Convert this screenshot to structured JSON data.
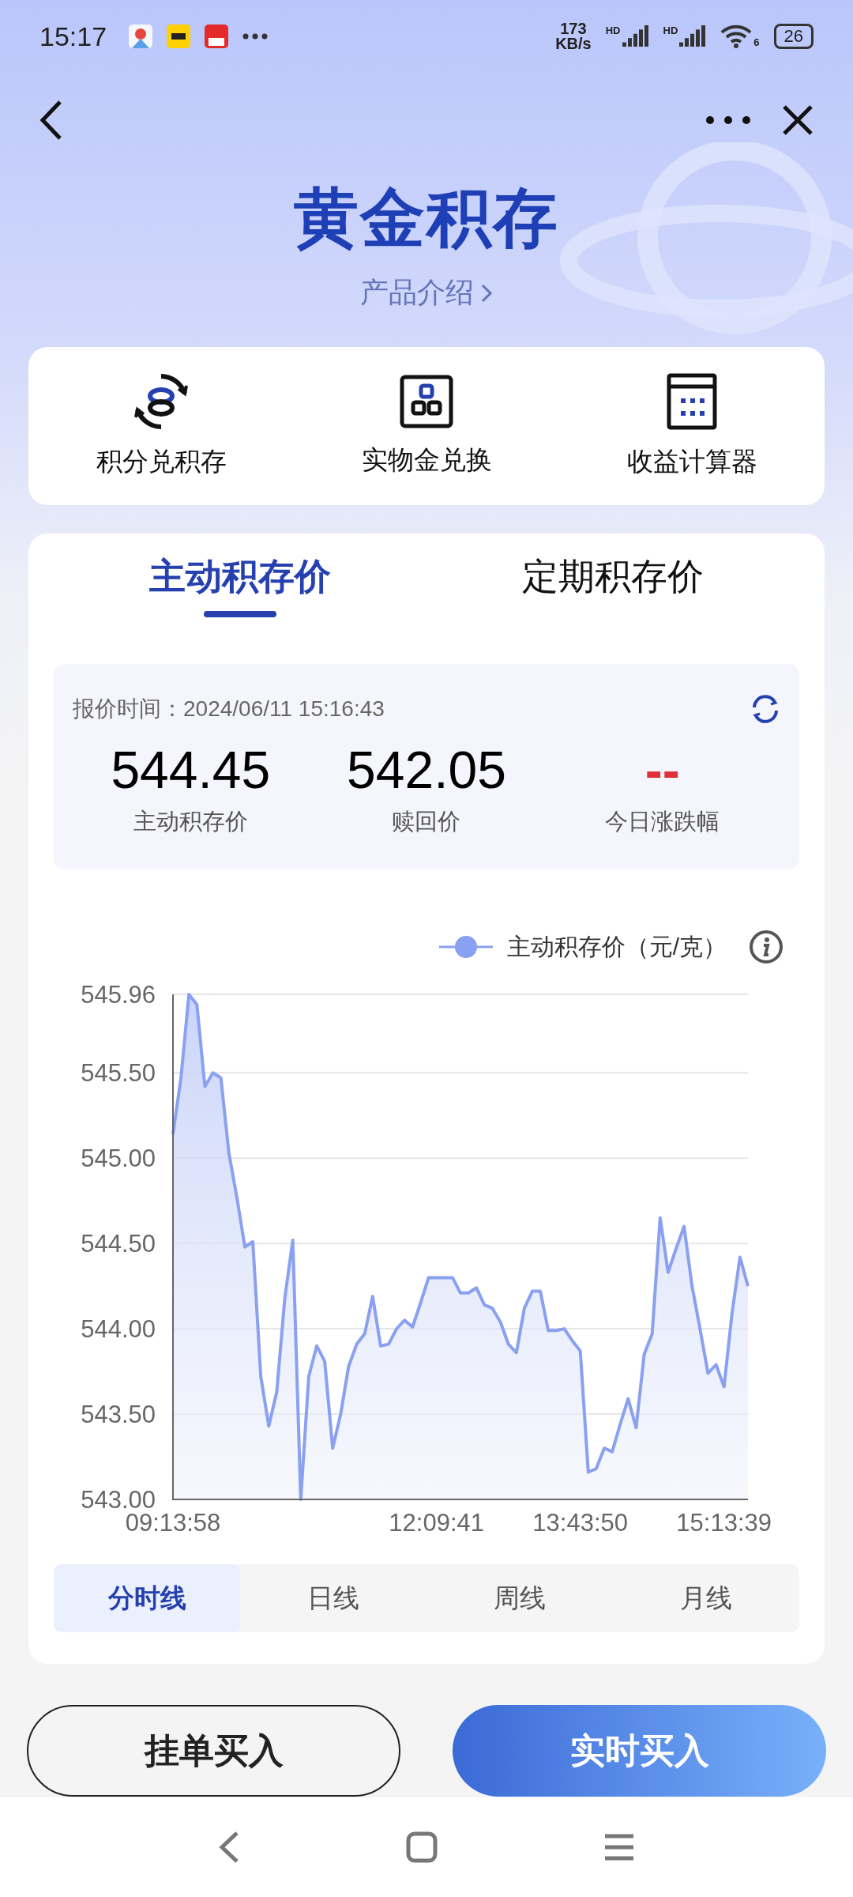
{
  "status_bar": {
    "time": "15:17",
    "net_speed": [
      "173",
      "KB/s"
    ],
    "signals": [
      {
        "label": "HD"
      },
      {
        "label": "HD"
      }
    ],
    "wifi_label": "6",
    "battery": "26"
  },
  "header": {
    "title": "黄金积存",
    "subtitle": "产品介绍"
  },
  "shortcuts": [
    {
      "kind": "exchange",
      "label": "积分兑积存"
    },
    {
      "kind": "gold",
      "label": "实物金兑换"
    },
    {
      "kind": "calculator",
      "label": "收益计算器"
    }
  ],
  "price_tabs": [
    {
      "label": "主动积存价",
      "selected": true
    },
    {
      "label": "定期积存价",
      "selected": false
    }
  ],
  "quote": {
    "time": "报价时间：2024/06/11 15:16:43",
    "prices": [
      {
        "value": "544.45",
        "label": "主动积存价",
        "kind": "price"
      },
      {
        "value": "542.05",
        "label": "赎回价",
        "kind": "price"
      },
      {
        "value": "--",
        "label": "今日涨跌幅",
        "kind": "change"
      }
    ]
  },
  "chart": {
    "chart_data": {
      "type": "line",
      "grid": true,
      "ylim": [
        543,
        545.96
      ],
      "categories": [
        "09:13:58",
        null,
        null,
        null,
        null,
        null,
        null,
        null,
        null,
        null,
        null,
        null,
        null,
        null,
        null,
        null,
        null,
        null,
        null,
        null,
        null,
        null,
        null,
        null,
        null,
        null,
        null,
        null,
        null,
        null,
        null,
        null,
        null,
        "12:09:41",
        null,
        null,
        null,
        null,
        null,
        null,
        null,
        null,
        null,
        null,
        null,
        null,
        null,
        null,
        null,
        null,
        null,
        "13:43:50",
        null,
        null,
        null,
        null,
        null,
        null,
        null,
        null,
        null,
        null,
        null,
        null,
        null,
        null,
        null,
        null,
        null,
        "15:13:39",
        null,
        null,
        null
      ],
      "yticks": [
        {
          "value": 543,
          "label": "543.00"
        },
        {
          "value": 543.5,
          "label": "543.50"
        },
        {
          "value": 544,
          "label": "544.00"
        },
        {
          "value": 544.5,
          "label": "544.50"
        },
        {
          "value": 545,
          "label": "545.00"
        },
        {
          "value": 545.5,
          "label": "545.50"
        },
        {
          "value": 545.96,
          "label": "545.96"
        }
      ],
      "series": [
        {
          "name": "主动积存价（元/克）",
          "color": "#8aa0f0",
          "values": [
            545.14,
            545.47,
            545.96,
            545.9,
            545.42,
            545.5,
            545.47,
            545.03,
            544.77,
            544.48,
            544.51,
            543.72,
            543.43,
            543.63,
            544.18,
            544.52,
            543.0,
            543.72,
            543.9,
            543.81,
            543.3,
            543.5,
            543.78,
            543.91,
            543.97,
            544.19,
            543.9,
            543.91,
            544.0,
            544.05,
            544.01,
            544.15,
            544.3,
            544.3,
            544.3,
            544.3,
            544.21,
            544.21,
            544.24,
            544.14,
            544.12,
            544.04,
            543.91,
            543.86,
            544.12,
            544.22,
            544.22,
            543.99,
            543.99,
            544.0,
            543.93,
            543.87,
            543.16,
            543.18,
            543.3,
            543.28,
            543.44,
            543.59,
            543.42,
            543.85,
            543.97,
            544.65,
            544.33,
            544.47,
            544.6,
            544.25,
            544.0,
            543.74,
            543.79,
            543.66,
            544.09,
            544.42,
            544.25
          ]
        }
      ]
    }
  },
  "period_tabs": [
    {
      "label": "分时线",
      "selected": true
    },
    {
      "label": "日线",
      "selected": false
    },
    {
      "label": "周线",
      "selected": false
    },
    {
      "label": "月线",
      "selected": false
    }
  ],
  "actions": [
    {
      "label": "挂单买入",
      "kind": "outline"
    },
    {
      "label": "实时买入",
      "kind": "primary"
    }
  ]
}
